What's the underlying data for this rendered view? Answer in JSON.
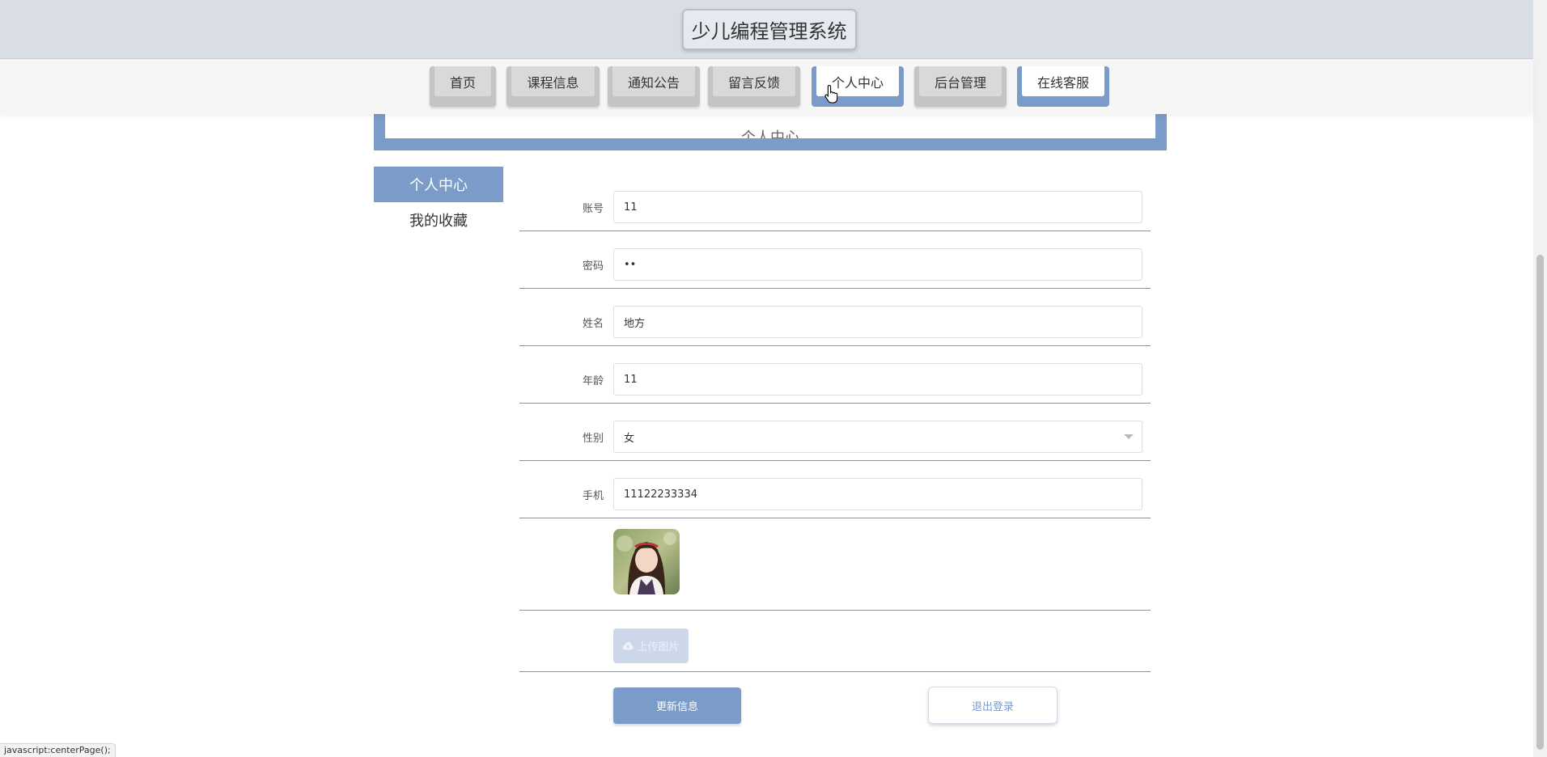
{
  "header": {
    "title": "少儿编程管理系统"
  },
  "nav": {
    "items": [
      {
        "label": "首页",
        "active": false
      },
      {
        "label": "课程信息",
        "active": false
      },
      {
        "label": "通知公告",
        "active": false
      },
      {
        "label": "留言反馈",
        "active": false
      },
      {
        "label": "个人中心",
        "active": true
      },
      {
        "label": "后台管理",
        "active": false
      },
      {
        "label": "在线客服",
        "active": true
      }
    ]
  },
  "banner": {
    "title": "个人中心"
  },
  "side_menu": {
    "items": [
      {
        "label": "个人中心",
        "active": true
      },
      {
        "label": "我的收藏",
        "active": false
      }
    ]
  },
  "form": {
    "account": {
      "label": "账号",
      "value": "11"
    },
    "password": {
      "label": "密码",
      "value": "••"
    },
    "name": {
      "label": "姓名",
      "value": "地方"
    },
    "age": {
      "label": "年龄",
      "value": "11"
    },
    "gender": {
      "label": "性别",
      "value": "女"
    },
    "phone": {
      "label": "手机",
      "value": "11122233334"
    },
    "upload_label": "上传图片"
  },
  "buttons": {
    "update": "更新信息",
    "logout": "退出登录"
  },
  "status_bar": {
    "text": "javascript:centerPage();"
  },
  "colors": {
    "accent": "#7b9cc8",
    "header_bg": "#d9dee6",
    "nav_bg": "#f6f6f6"
  }
}
